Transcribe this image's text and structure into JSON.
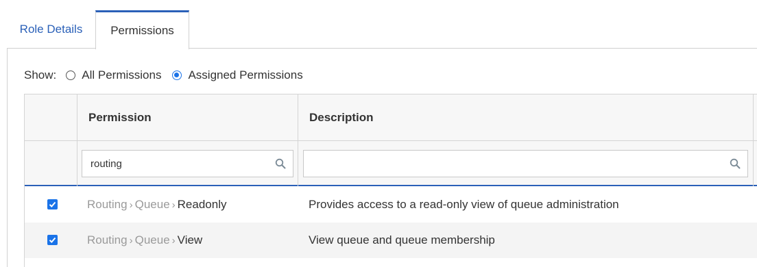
{
  "tabs": [
    {
      "label": "Role Details",
      "active": false
    },
    {
      "label": "Permissions",
      "active": true
    }
  ],
  "show": {
    "label": "Show:",
    "options": [
      {
        "label": "All Permissions",
        "selected": false
      },
      {
        "label": "Assigned Permissions",
        "selected": true
      }
    ]
  },
  "grid": {
    "columns": {
      "permission": "Permission",
      "description": "Description"
    },
    "filters": {
      "permission": "routing",
      "description": ""
    },
    "rows": [
      {
        "checked": true,
        "path": [
          "Routing",
          "Queue"
        ],
        "leaf": "Readonly",
        "description": "Provides access to a read-only view of queue administration"
      },
      {
        "checked": true,
        "path": [
          "Routing",
          "Queue"
        ],
        "leaf": "View",
        "description": "View queue and queue membership"
      }
    ]
  },
  "colors": {
    "accent": "#2a60b8",
    "checkbox": "#1a73e8"
  },
  "icons": {
    "filter": "search-icon",
    "separator": "chevron-right"
  }
}
